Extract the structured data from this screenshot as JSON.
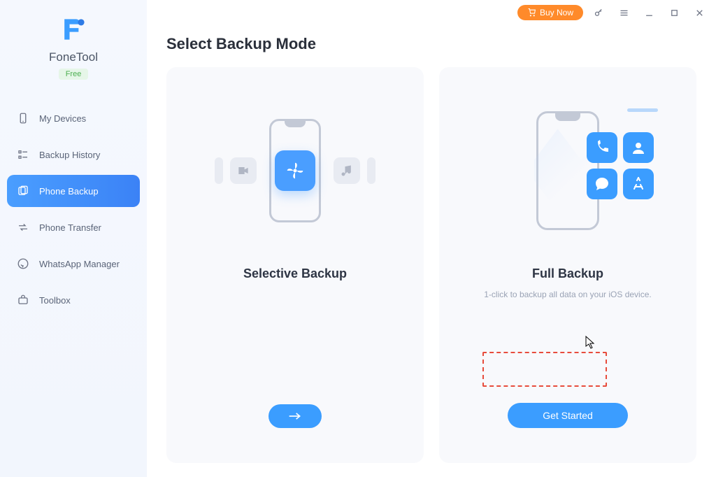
{
  "app": {
    "name": "FoneTool",
    "badge": "Free"
  },
  "titlebar": {
    "buy": "Buy Now"
  },
  "sidebar": {
    "items": [
      {
        "id": "my-devices",
        "label": "My Devices",
        "active": false
      },
      {
        "id": "backup-history",
        "label": "Backup History",
        "active": false
      },
      {
        "id": "phone-backup",
        "label": "Phone Backup",
        "active": true
      },
      {
        "id": "phone-transfer",
        "label": "Phone Transfer",
        "active": false
      },
      {
        "id": "whatsapp-manager",
        "label": "WhatsApp Manager",
        "active": false
      },
      {
        "id": "toolbox",
        "label": "Toolbox",
        "active": false
      }
    ]
  },
  "main": {
    "title": "Select Backup Mode",
    "cards": {
      "selective": {
        "title": "Selective Backup",
        "subtitle": "",
        "button": "→"
      },
      "full": {
        "title": "Full Backup",
        "subtitle": "1-click to backup all data on your iOS device.",
        "button": "Get Started"
      }
    }
  }
}
